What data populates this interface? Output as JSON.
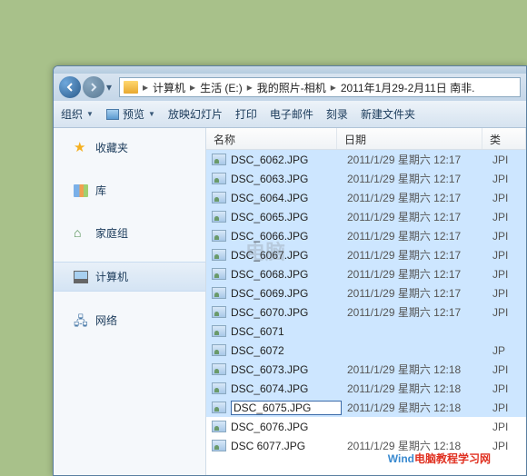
{
  "path": {
    "segments": [
      "计算机",
      "生活 (E:)",
      "我的照片-相机",
      "2011年1月29-2月11日 南非."
    ]
  },
  "toolbar": {
    "organize": "组织",
    "preview": "预览",
    "slideshow": "放映幻灯片",
    "print": "打印",
    "email": "电子邮件",
    "burn": "刻录",
    "newfolder": "新建文件夹"
  },
  "sidebar": {
    "favorites": "收藏夹",
    "library": "库",
    "homegroup": "家庭组",
    "computer": "计算机",
    "network": "网络"
  },
  "columns": {
    "name": "名称",
    "date": "日期",
    "type": "类"
  },
  "files": [
    {
      "name": "DSC_6062.JPG",
      "date": "2011/1/29 星期六 12:17",
      "type": "JPI",
      "sel": true
    },
    {
      "name": "DSC_6063.JPG",
      "date": "2011/1/29 星期六 12:17",
      "type": "JPI",
      "sel": true
    },
    {
      "name": "DSC_6064.JPG",
      "date": "2011/1/29 星期六 12:17",
      "type": "JPI",
      "sel": true
    },
    {
      "name": "DSC_6065.JPG",
      "date": "2011/1/29 星期六 12:17",
      "type": "JPI",
      "sel": true
    },
    {
      "name": "DSC_6066.JPG",
      "date": "2011/1/29 星期六 12:17",
      "type": "JPI",
      "sel": true
    },
    {
      "name": "DSC_6067.JPG",
      "date": "2011/1/29 星期六 12:17",
      "type": "JPI",
      "sel": true
    },
    {
      "name": "DSC_6068.JPG",
      "date": "2011/1/29 星期六 12:17",
      "type": "JPI",
      "sel": true
    },
    {
      "name": "DSC_6069.JPG",
      "date": "2011/1/29 星期六 12:17",
      "type": "JPI",
      "sel": true
    },
    {
      "name": "DSC_6070.JPG",
      "date": "2011/1/29 星期六 12:17",
      "type": "JPI",
      "sel": true
    },
    {
      "name": "DSC_6071",
      "date": "",
      "type": "",
      "sel": true
    },
    {
      "name": "DSC_6072",
      "date": "",
      "type": "JP",
      "sel": true
    },
    {
      "name": "DSC_6073.JPG",
      "date": "2011/1/29 星期六 12:18",
      "type": "JPI",
      "sel": true
    },
    {
      "name": "DSC_6074.JPG",
      "date": "2011/1/29 星期六 12:18",
      "type": "JPI",
      "sel": true
    },
    {
      "name": "DSC_6075.JPG",
      "date": "2011/1/29 星期六 12:18",
      "type": "JPI",
      "sel": true,
      "rename": true
    },
    {
      "name": "DSC_6076.JPG",
      "date": "",
      "type": "JPI",
      "sel": false
    },
    {
      "name": "DSC 6077.JPG",
      "date": "2011/1/29 星期六 12:18",
      "type": "JPI",
      "sel": false
    }
  ],
  "watermark": {
    "w1": "Wind",
    "w2": "电脑教程学习网"
  },
  "wm2": "电脑"
}
